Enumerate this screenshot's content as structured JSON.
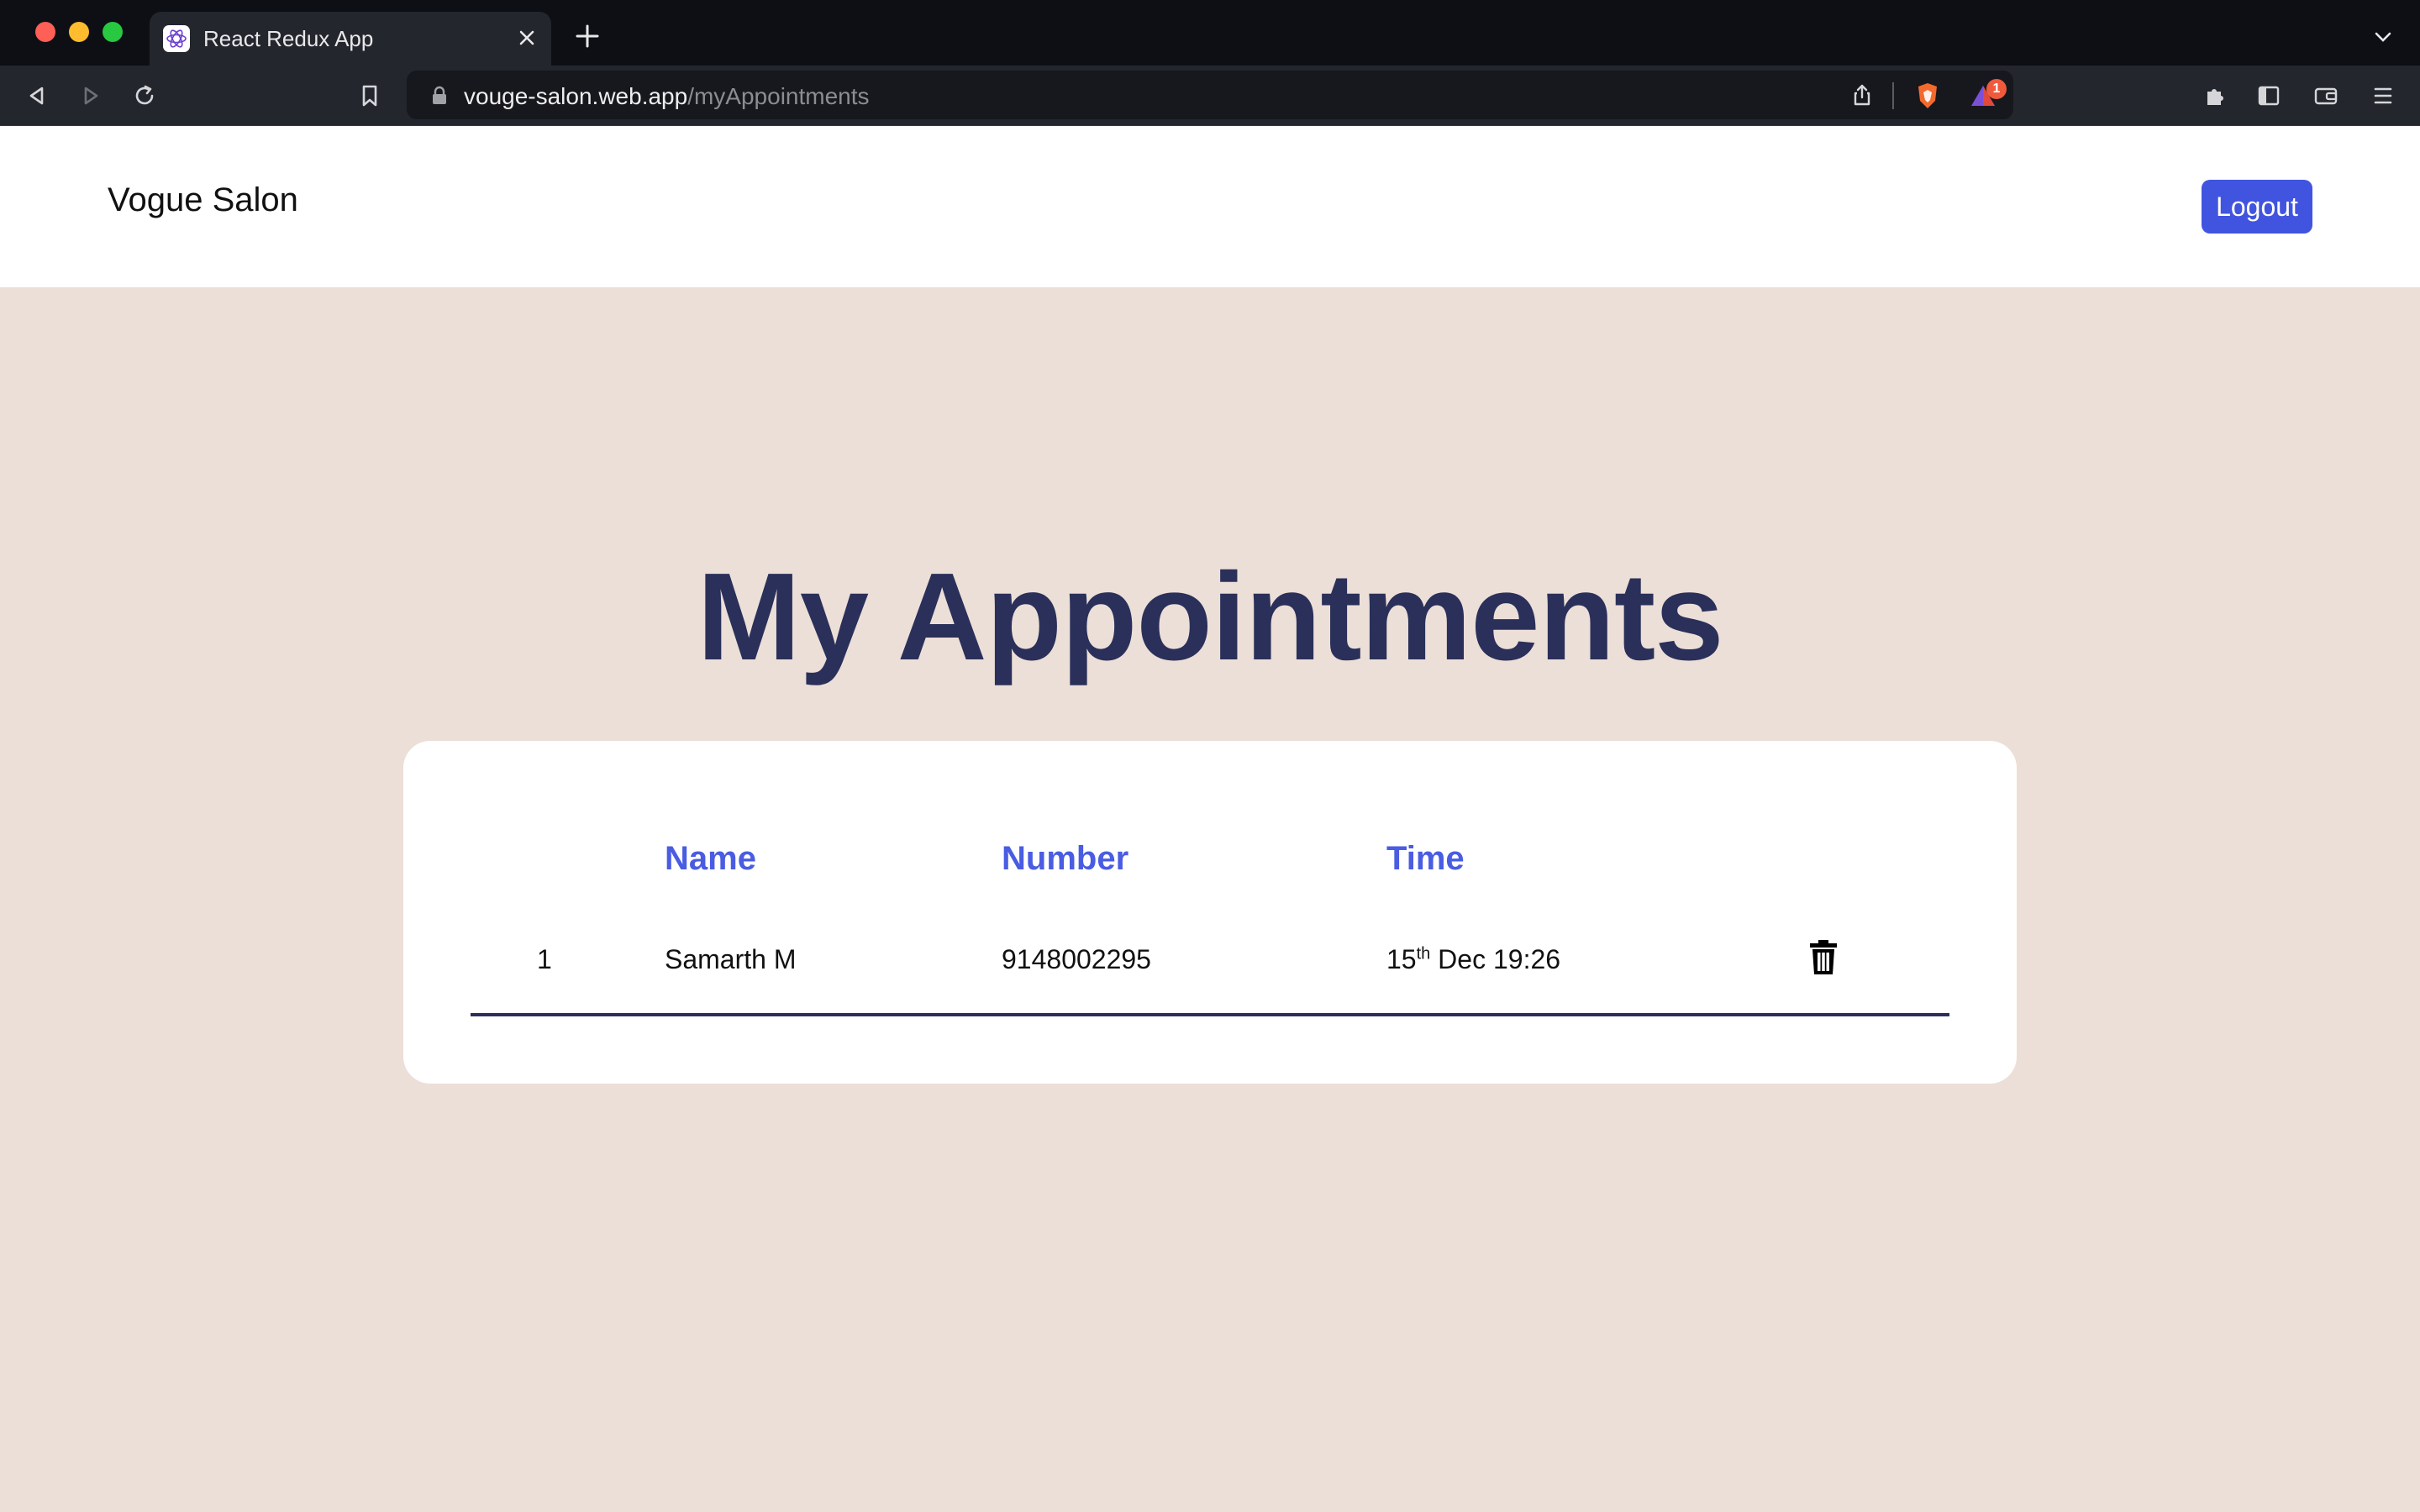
{
  "browser": {
    "tab_title": "React Redux App",
    "url_host": "vouge-salon.web.app",
    "url_path": "/myAppointments",
    "notification_count": "1"
  },
  "navbar": {
    "brand": "Vogue Salon",
    "logout_label": "Logout"
  },
  "page": {
    "title": "My Appointments"
  },
  "table": {
    "headers": {
      "name": "Name",
      "number": "Number",
      "time": "Time"
    },
    "rows": [
      {
        "index": "1",
        "name": "Samarth M",
        "number": "9148002295",
        "day": "15",
        "day_suffix": "th",
        "time_rest": " Dec 19:26"
      }
    ]
  },
  "colors": {
    "accent": "#4154e0",
    "title": "#2a3059",
    "page_bg": "#ecdfd8"
  },
  "icons": [
    "close-icon",
    "plus-icon",
    "back-icon",
    "forward-icon",
    "reload-icon",
    "bookmark-icon",
    "lock-icon",
    "share-icon",
    "brave-shield-icon",
    "brave-rewards-icon",
    "extensions-icon",
    "sidebar-icon",
    "wallet-icon",
    "menu-icon",
    "trash-icon"
  ]
}
